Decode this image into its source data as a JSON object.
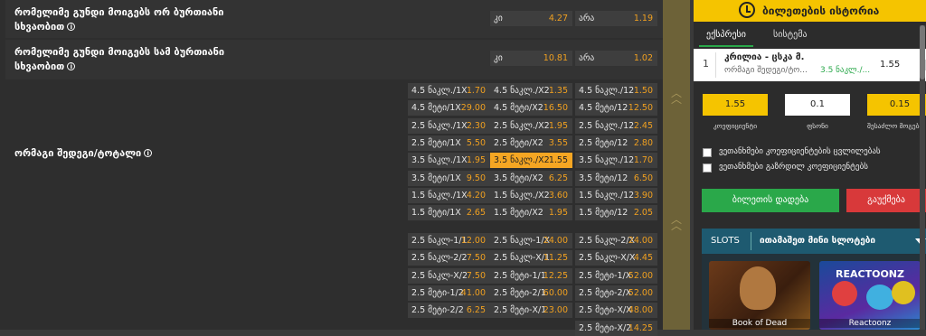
{
  "markets": [
    {
      "title": "რომელიმე გუნდი მოიგებს ორ ბურთიანი სხვაობით",
      "odds": [
        {
          "label": "კი",
          "value": "4.27"
        },
        {
          "label": "არა",
          "value": "1.19"
        }
      ]
    },
    {
      "title": "რომელიმე გუნდი მოიგებს სამ ბურთიანი სხვაობით",
      "odds": [
        {
          "label": "კი",
          "value": "10.81"
        },
        {
          "label": "არა",
          "value": "1.02"
        }
      ]
    },
    {
      "title": "ორმაგი შედეგი/ტოტალი"
    },
    {
      "title": ""
    }
  ],
  "dc_total": [
    [
      {
        "l": "4.5 ნაკლ./1X",
        "v": "1.70"
      },
      {
        "l": "4.5 ნაკლ./X2",
        "v": "1.35"
      },
      {
        "l": "4.5 ნაკლ./12",
        "v": "1.50"
      }
    ],
    [
      {
        "l": "4.5 მეტი/1X",
        "v": "29.00"
      },
      {
        "l": "4.5 მეტი/X2",
        "v": "16.50"
      },
      {
        "l": "4.5 მეტი/12",
        "v": "12.50"
      }
    ],
    [
      {
        "l": "2.5 ნაკლ./1X",
        "v": "2.30"
      },
      {
        "l": "2.5 ნაკლ./X2",
        "v": "1.95"
      },
      {
        "l": "2.5 ნაკლ./12",
        "v": "2.45"
      }
    ],
    [
      {
        "l": "2.5 მეტი/1X",
        "v": "5.50"
      },
      {
        "l": "2.5 მეტი/X2",
        "v": "3.55"
      },
      {
        "l": "2.5 მეტი/12",
        "v": "2.80"
      }
    ],
    [
      {
        "l": "3.5 ნაკლ./1X",
        "v": "1.95"
      },
      {
        "l": "3.5 ნაკლ./X2",
        "v": "1.55"
      },
      {
        "l": "3.5 ნაკლ./12",
        "v": "1.70"
      }
    ],
    [
      {
        "l": "3.5 მეტი/1X",
        "v": "9.50"
      },
      {
        "l": "3.5 მეტი/X2",
        "v": "6.25"
      },
      {
        "l": "3.5 მეტი/12",
        "v": "6.50"
      }
    ],
    [
      {
        "l": "1.5 ნაკლ./1X",
        "v": "4.20"
      },
      {
        "l": "1.5 ნაკლ./X2",
        "v": "3.60"
      },
      {
        "l": "1.5 ნაკლ./12",
        "v": "3.90"
      }
    ],
    [
      {
        "l": "1.5 მეტი/1X",
        "v": "2.65"
      },
      {
        "l": "1.5 მეტი/X2",
        "v": "1.95"
      },
      {
        "l": "1.5 მეტი/12",
        "v": "2.05"
      }
    ]
  ],
  "htft_total": [
    [
      {
        "l": "2.5 ნაკლ-1/1",
        "v": "12.00"
      },
      {
        "l": "2.5 ნაკლ-1/X",
        "v": "24.00"
      },
      {
        "l": "2.5 ნაკლ-2/X",
        "v": "24.00"
      }
    ],
    [
      {
        "l": "2.5 ნაკლ-2/2",
        "v": "7.50"
      },
      {
        "l": "2.5 ნაკლ-X/1",
        "v": "11.25"
      },
      {
        "l": "2.5 ნაკლ-X/X",
        "v": "4.45"
      }
    ],
    [
      {
        "l": "2.5 ნაკლ-X/2",
        "v": "7.50"
      },
      {
        "l": "2.5 მეტი-1/1",
        "v": "12.25"
      },
      {
        "l": "2.5 მეტი-1/X",
        "v": "52.00"
      }
    ],
    [
      {
        "l": "2.5 მეტი-1/2",
        "v": "41.00"
      },
      {
        "l": "2.5 მეტი-2/1",
        "v": "60.00"
      },
      {
        "l": "2.5 მეტი-2/X",
        "v": "52.00"
      }
    ],
    [
      {
        "l": "2.5 მეტი-2/2",
        "v": "6.25"
      },
      {
        "l": "2.5 მეტი-X/1",
        "v": "23.00"
      },
      {
        "l": "2.5 მეტი-X/X",
        "v": "48.00"
      }
    ],
    [
      {
        "l": "",
        "v": ""
      },
      {
        "l": "",
        "v": ""
      },
      {
        "l": "2.5 მეტი-X/2",
        "v": "14.25"
      }
    ]
  ],
  "sidebar": {
    "history_label": "ბილეთების ისტორია",
    "tab_express": "ექსპრესი",
    "tab_system": "სისტემა",
    "slip": {
      "num": "1",
      "teams": "კრილია - ცსკა მ.",
      "market": "ორმაგი შედეგი/ტო...",
      "pick": "3.5 ნაკლ./...",
      "odds": "1.55"
    },
    "coef_value": "1.55",
    "stake_value": "0.1",
    "payout_value": "0.15",
    "coef_label": "კოეფიციენტი",
    "stake_label": "ფსონი",
    "payout_label": "შესაძლო მოგება",
    "check1": "ვეთანხმები კოეფიციენტების ცვლილებას",
    "check2": "ვეთანხმები გაზრდილ კოეფიციენტებს",
    "place_bet": "ბილეთის დადება",
    "cancel": "გაუქმება",
    "slots_label": "SLOTS",
    "slots_title": "ითამაშეთ მინი სლოტები",
    "games": [
      "Book of Dead",
      "Reactoonz"
    ],
    "game2_logo": "REACTOONZ"
  },
  "colors": {
    "odds": "#f0a020",
    "selected": "#f5a623",
    "accent_yellow": "#f5c400",
    "green": "#2aa84a",
    "red": "#d8393a"
  }
}
